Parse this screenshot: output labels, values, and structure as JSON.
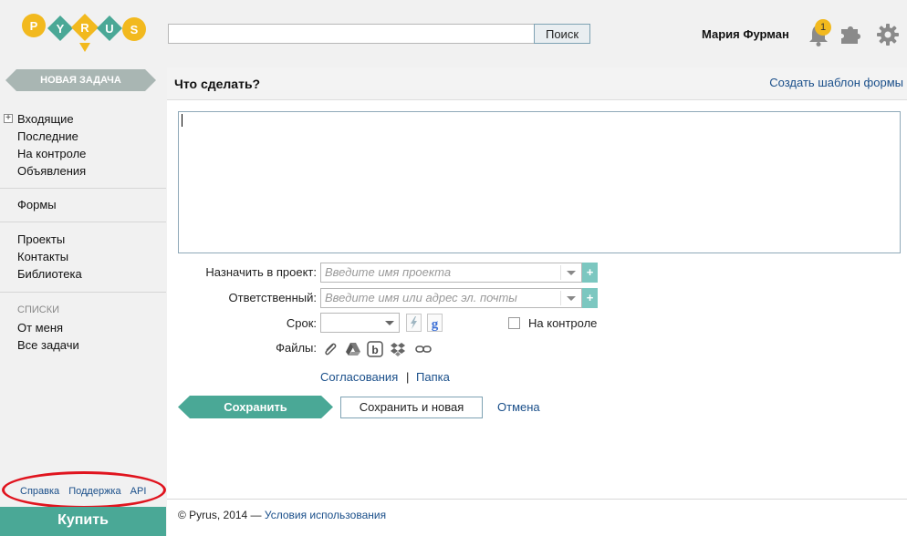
{
  "header": {
    "logo_letters": [
      "P",
      "Y",
      "R",
      "U",
      "S"
    ],
    "search_value": "",
    "search_button": "Поиск",
    "user_name": "Мария Фурман",
    "notification_count": "1"
  },
  "sidebar": {
    "new_task": "НОВАЯ ЗАДАЧА",
    "group1": [
      "Входящие",
      "Последние",
      "На контроле",
      "Объявления"
    ],
    "group2": [
      "Формы"
    ],
    "group3": [
      "Проекты",
      "Контакты",
      "Библиотека"
    ],
    "lists_title": "СПИСКИ",
    "group4": [
      "От меня",
      "Все задачи"
    ],
    "footer_links": [
      "Справка",
      "Поддержка",
      "API"
    ],
    "buy": "Купить"
  },
  "main": {
    "title": "Что сделать?",
    "template_link": "Создать шаблон формы",
    "task_text": "",
    "project_label": "Назначить в проект:",
    "project_placeholder": "Введите имя проекта",
    "responsible_label": "Ответственный:",
    "responsible_placeholder": "Введите имя или адрес эл. почты",
    "deadline_label": "Срок:",
    "deadline_value": "",
    "control_label": "На контроле",
    "files_label": "Файлы:",
    "approvals_link": "Согласования",
    "separator": "|",
    "folder_link": "Папка",
    "save": "Сохранить",
    "save_new": "Сохранить и новая",
    "cancel": "Отмена",
    "copyright": "© Pyrus, 2014 —",
    "terms_link": "Условия использования"
  },
  "colors": {
    "accent": "#4aa896",
    "logo_yellow": "#f2b91e",
    "logo_teal": "#4aa896",
    "link": "#1a4f8a",
    "callout": "#e0141e"
  },
  "icons": [
    "bell-icon",
    "puzzle-icon",
    "gear-icon",
    "lightning-icon",
    "google-calendar-icon",
    "paperclip-icon",
    "google-drive-icon",
    "box-icon",
    "dropbox-icon",
    "link-icon"
  ]
}
